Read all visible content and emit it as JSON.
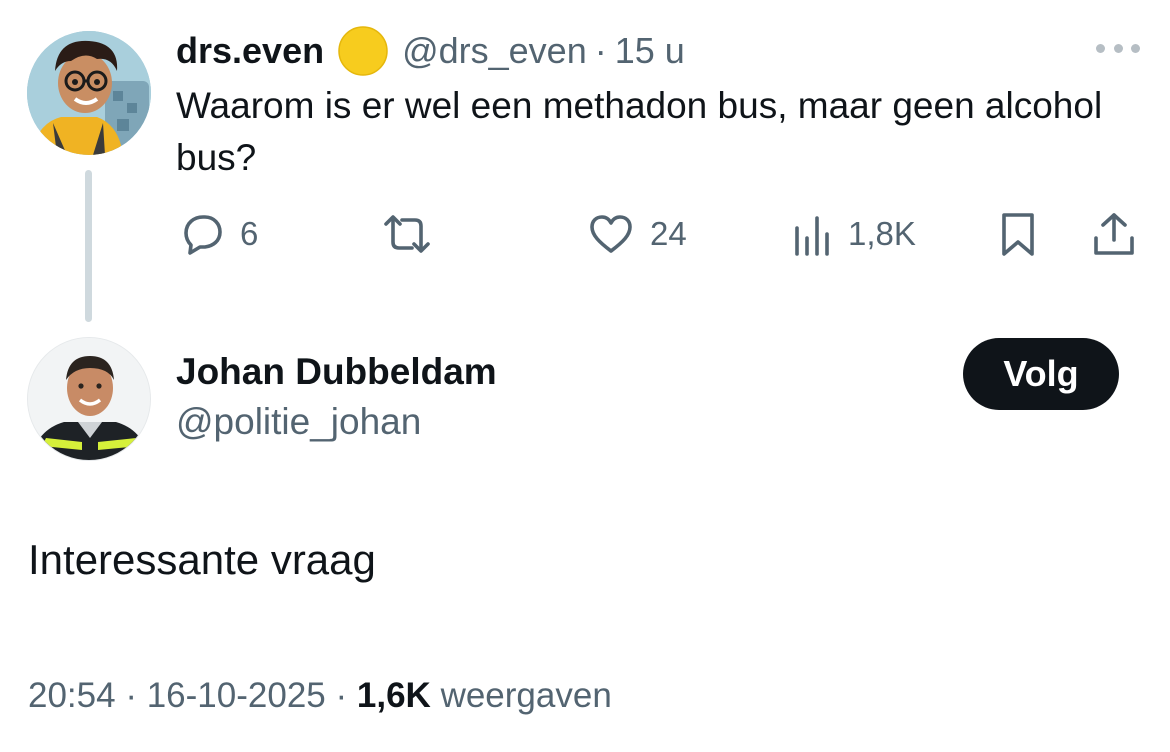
{
  "parent_tweet": {
    "author_name": "drs.even",
    "author_emoji": "🟡",
    "handle": "@drs_even",
    "separator": "·",
    "time": "15 u",
    "text": "Waarom is er wel een methadon bus, maar geen alcohol bus?",
    "avatar_icon": "cartoon-avatar-icon",
    "more_icon": "more-dots-icon",
    "actions": {
      "replies": "6",
      "retweets": "",
      "likes": "24",
      "views": "1,8K"
    }
  },
  "reply_tweet": {
    "author_name": "Johan Dubbeldam",
    "handle": "@politie_johan",
    "follow_label": "Volg",
    "text": "Interessante vraag",
    "time": "20:54",
    "separator": "·",
    "date": "16-10-2025",
    "views_count": "1,6K",
    "views_label": "weergaven"
  },
  "colors": {
    "text_primary": "#0f1419",
    "text_secondary": "#536471",
    "thread_line": "#cfd9de",
    "follow_bg": "#0f1419",
    "emoji_yellow": "#f7cc1e"
  }
}
